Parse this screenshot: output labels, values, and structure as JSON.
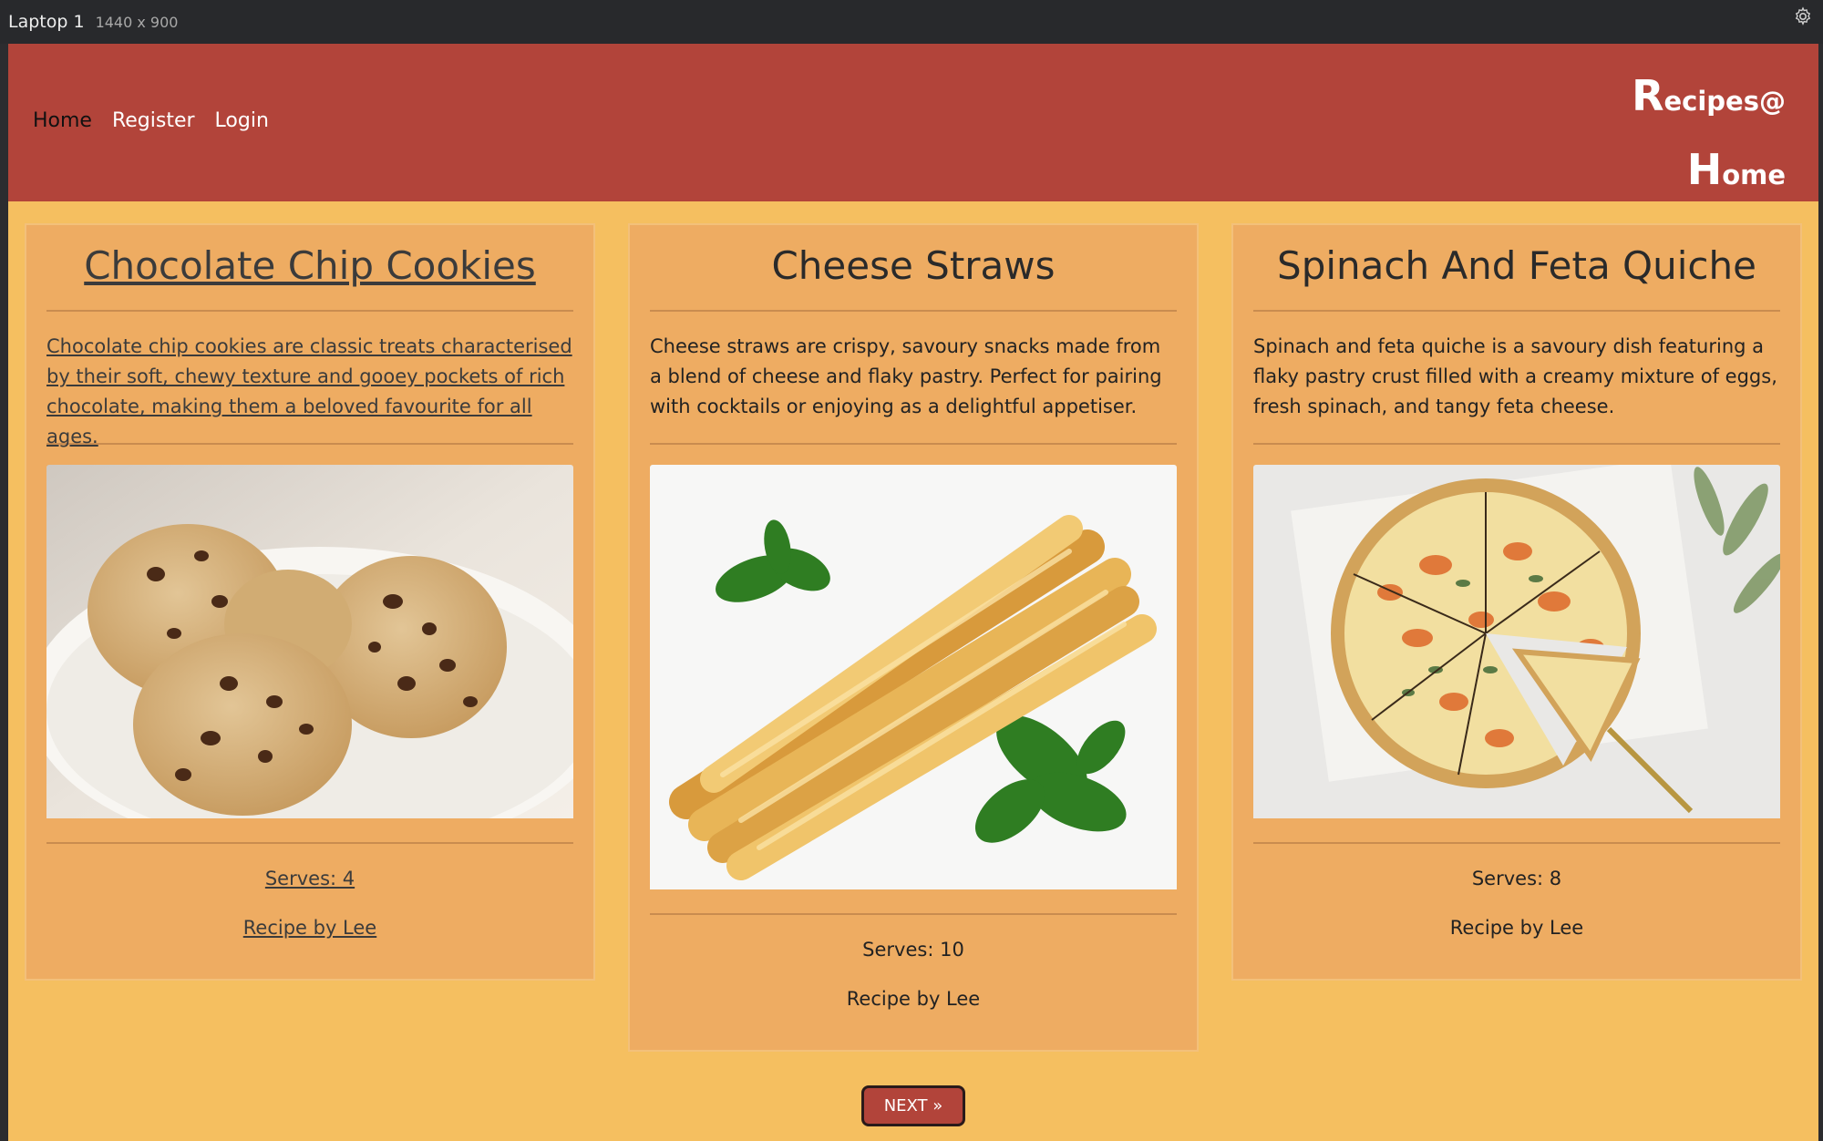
{
  "devtool": {
    "title": "Laptop 1",
    "size": "1440 x 900",
    "settings_icon": "gear-icon"
  },
  "nav": {
    "home": "Home",
    "register": "Register",
    "login": "Login"
  },
  "brand": {
    "line1_big": "R",
    "line1_rest": "ecipes@",
    "line2_big": "H",
    "line2_rest": "ome"
  },
  "cards": [
    {
      "title": "Chocolate Chip Cookies",
      "description": "Chocolate chip cookies are classic treats characterised by their soft, chewy texture and gooey pockets of rich chocolate, making them a beloved favourite for all ages.",
      "serves": "Serves: 4",
      "author": "Recipe by Lee",
      "image": "cookies-photo"
    },
    {
      "title": "Cheese Straws",
      "description": "Cheese straws are crispy, savoury snacks made from a blend of cheese and flaky pastry. Perfect for pairing with cocktails or enjoying as a delightful appetiser.",
      "serves": "Serves: 10",
      "author": "Recipe by Lee",
      "image": "cheese-straws-photo"
    },
    {
      "title": "Spinach And Feta Quiche",
      "description": "Spinach and feta quiche is a savoury dish featuring a flaky pastry crust filled with a creamy mixture of eggs, fresh spinach, and tangy feta cheese.",
      "serves": "Serves: 8",
      "author": "Recipe by Lee",
      "image": "quiche-photo"
    }
  ],
  "pagination": {
    "next_label": "NEXT »"
  },
  "colors": {
    "header": "#b2443a",
    "page": "#f5bf60",
    "card": "#eeac62",
    "button": "#b2443a"
  }
}
